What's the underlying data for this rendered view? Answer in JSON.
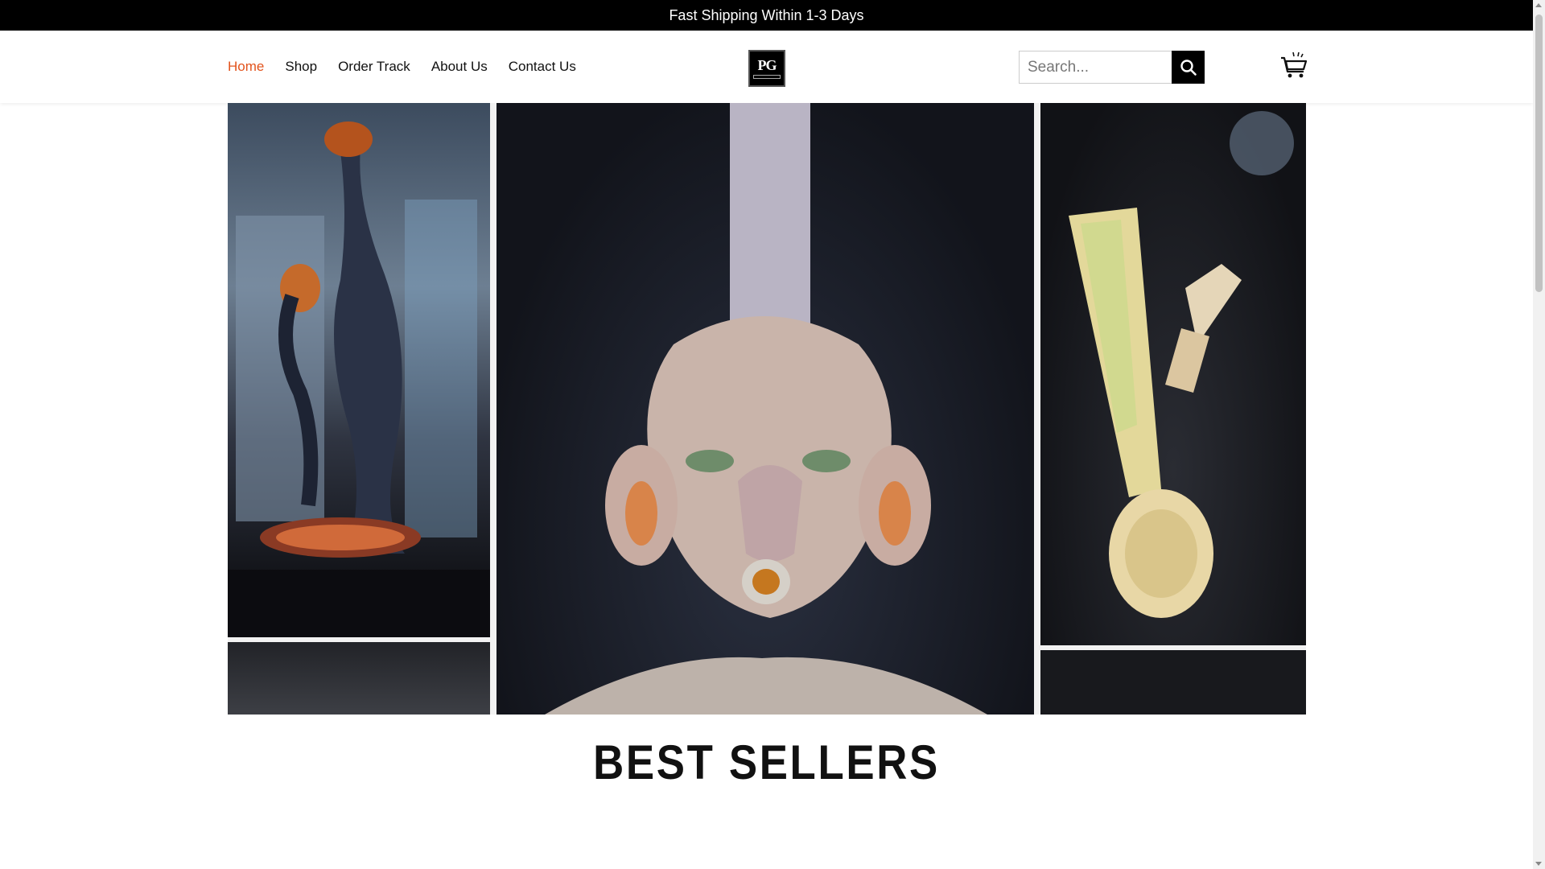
{
  "announcement": {
    "text": "Fast Shipping Within 1-3 Days"
  },
  "nav": {
    "items": [
      {
        "label": "Home",
        "active": true
      },
      {
        "label": "Shop",
        "active": false
      },
      {
        "label": "Order Track",
        "active": false
      },
      {
        "label": "About Us",
        "active": false
      },
      {
        "label": "Contact Us",
        "active": false
      }
    ]
  },
  "logo": {
    "text": "PG"
  },
  "search": {
    "placeholder": "Search...",
    "value": "",
    "icon": "search-icon"
  },
  "cart": {
    "icon": "shopping-cart-icon"
  },
  "hero": {
    "image": "glass-pipes-collage"
  },
  "section": {
    "title": "BEST SELLERS"
  },
  "colors": {
    "accent": "#e2531c",
    "announcement_bg": "#000000",
    "text": "#111111"
  }
}
